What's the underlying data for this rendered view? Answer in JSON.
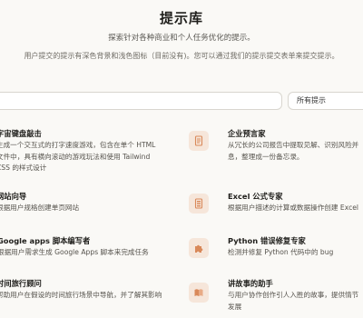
{
  "header": {
    "title": "提示库",
    "subtitle": "探索针对各种商业和个人任务优化的提示。",
    "note": "用户提交的提示有深色背景和浅色图标（目前没有)。您可以通过我们的提示提交表单来提交提示。"
  },
  "search": {
    "value": "",
    "placeholder": ""
  },
  "filter": {
    "selected": "所有提示"
  },
  "colors": {
    "icon_bg": "#f6e6da",
    "icon_fg": "#d9895a",
    "background": "#faf9f6"
  },
  "cards": [
    {
      "title": "字宙键盘敲击",
      "desc": [
        "生成一个交互式的打字速度游戏，包含在单个 HTML",
        "文件中，具有横向滚动的游戏玩法和使用 Tailwind",
        "CSS 的样式设计"
      ]
    },
    {
      "title": "企业预言家",
      "icon": "document-icon",
      "desc": [
        "从冗长的公司报告中提取见解、识别风险并",
        "息，整理成一份备忘录。"
      ]
    },
    {
      "title": "网站向导",
      "desc": [
        "根据用户规格创建单页网站"
      ]
    },
    {
      "title": "Excel 公式专家",
      "icon": "spreadsheet-icon",
      "desc": [
        "根据用户描述的计算或数据操作创建 Excel"
      ]
    },
    {
      "title": "Google apps 脚本编写者",
      "desc": [
        "根据用户需求生成 Google Apps 脚本来完成任务"
      ]
    },
    {
      "title": "Python 错误修复专家",
      "icon": "puzzle-icon",
      "desc": [
        "检测并修复 Python 代码中的 bug"
      ]
    },
    {
      "title": "时间旅行顾问",
      "desc": [
        "帮助用户在假设的时间旅行场景中导航，并了解其影响"
      ]
    },
    {
      "title": "讲故事的助手",
      "icon": "book-icon",
      "desc": [
        "与用户协作创作引人入胜的故事，提供情节",
        "发展"
      ]
    }
  ]
}
